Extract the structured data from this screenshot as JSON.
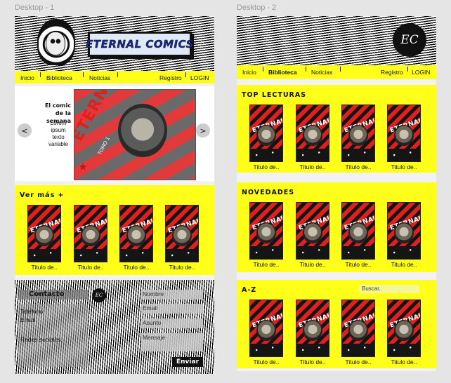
{
  "frames": [
    {
      "label": "Desktop - 1"
    },
    {
      "label": "Desktop - 2"
    }
  ],
  "desktop1": {
    "logo_text": "ETERNAL COMICS",
    "nav": {
      "inicio": "Inicio",
      "biblioteca": "Biblioteca",
      "noticias": "Noticias",
      "registro": "Registro",
      "login": "LOGIN"
    },
    "hero": {
      "title_line1": "El comic",
      "title_line2": "de la semana",
      "desc": [
        "Lorem",
        "ipsum",
        "texto",
        "variable"
      ],
      "prev": "<",
      "next": ">",
      "cover_title": "ETERNAUTA",
      "cover_subtitle": "TOMO 1"
    },
    "ver_mas": {
      "title": "Ver más +",
      "items": [
        "Titulo de..",
        "Titulo de..",
        "Titulo de..",
        "Titulo de.."
      ]
    },
    "contact": {
      "title": "Contacto",
      "telefono": "Telefono",
      "email": "Email",
      "redes": "Redes sociales",
      "fields": {
        "nombre": "Nombre",
        "email": "Email",
        "asunto": "Asunto",
        "mensaje": "Mensaje"
      },
      "send": "Enviar",
      "badge": "EC"
    }
  },
  "desktop2": {
    "badge": "EC",
    "nav": {
      "inicio": "Inicio",
      "biblioteca": "Biblioteca",
      "noticias": "Noticias",
      "registro": "Registro",
      "login": "LOGIN"
    },
    "top": {
      "title": "TOP LECTURAS",
      "items": [
        "Titulo de..",
        "Titulo de..",
        "Titulo de..",
        "Titulo de.."
      ]
    },
    "nov": {
      "title": "NOVEDADES",
      "items": [
        "Titulo de..",
        "Titulo de..",
        "Titulo de..",
        "Titulo de.."
      ]
    },
    "az": {
      "title": "A-Z",
      "search_placeholder": "Buscar..",
      "items": [
        "Titulo de..",
        "Titulo de..",
        "Titulo de..",
        "Titulo de.."
      ]
    }
  },
  "cover_text": "ETERNAUTA",
  "colors": {
    "accent": "#ffff1a",
    "cover_red": "#e01f1f",
    "dark": "#141414"
  }
}
